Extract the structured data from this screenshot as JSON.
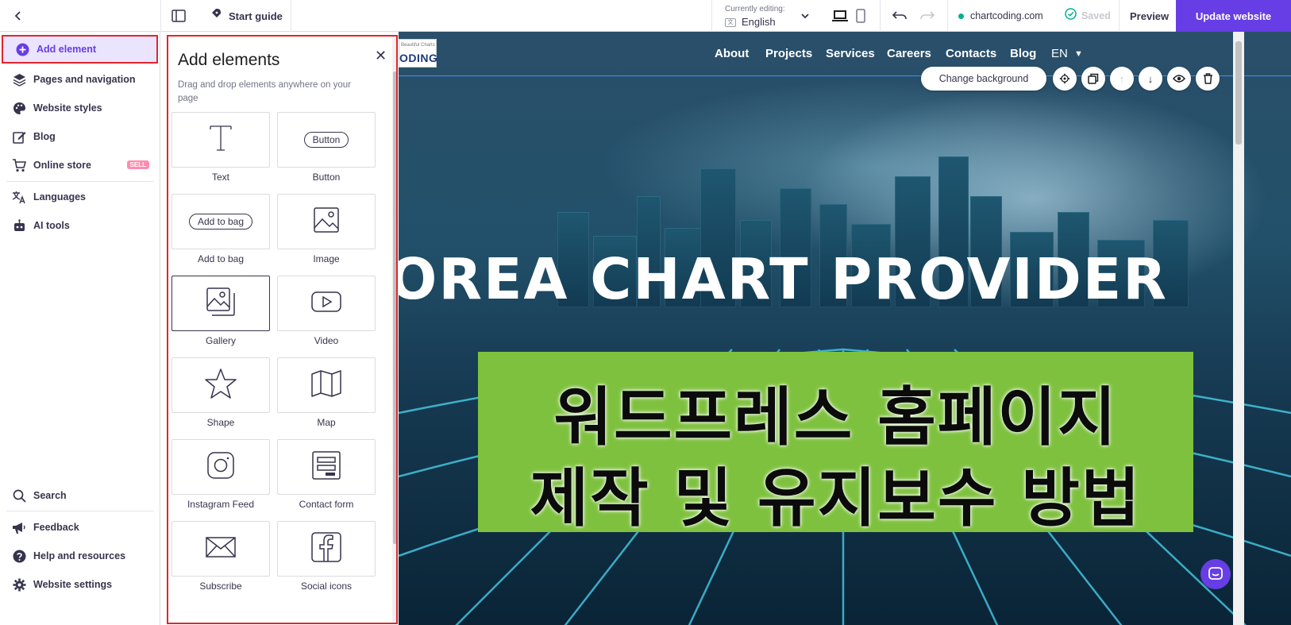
{
  "topbar": {
    "start_guide": "Start guide",
    "currently_editing_label": "Currently editing:",
    "language": "English",
    "domain": "chartcoding.com",
    "saved": "Saved",
    "preview": "Preview",
    "update_website": "Update website"
  },
  "sidebar": {
    "items": [
      {
        "label": "Add element",
        "icon": "plus-circle-icon"
      },
      {
        "label": "Pages and navigation",
        "icon": "layers-icon"
      },
      {
        "label": "Website styles",
        "icon": "palette-icon"
      },
      {
        "label": "Blog",
        "icon": "edit-icon"
      },
      {
        "label": "Online store",
        "icon": "cart-icon",
        "badge": "SELL"
      },
      {
        "label": "Languages",
        "icon": "translate-icon"
      },
      {
        "label": "AI tools",
        "icon": "robot-icon"
      }
    ],
    "bottom": [
      {
        "label": "Search",
        "icon": "search-icon"
      },
      {
        "label": "Feedback",
        "icon": "megaphone-icon"
      },
      {
        "label": "Help and resources",
        "icon": "help-icon"
      },
      {
        "label": "Website settings",
        "icon": "gear-icon"
      }
    ]
  },
  "panel": {
    "title": "Add elements",
    "subtitle": "Drag and drop elements anywhere on your page",
    "tiles": [
      {
        "label": "Text",
        "icon": "text-icon"
      },
      {
        "label": "Button",
        "icon": "button-icon",
        "pill": "Button"
      },
      {
        "label": "Add to bag",
        "icon": "add-to-bag-icon",
        "pill": "Add to bag"
      },
      {
        "label": "Image",
        "icon": "image-icon"
      },
      {
        "label": "Gallery",
        "icon": "gallery-icon"
      },
      {
        "label": "Video",
        "icon": "video-icon"
      },
      {
        "label": "Shape",
        "icon": "star-icon"
      },
      {
        "label": "Map",
        "icon": "map-icon"
      },
      {
        "label": "Instagram Feed",
        "icon": "instagram-icon"
      },
      {
        "label": "Contact form",
        "icon": "contact-form-icon"
      },
      {
        "label": "Subscribe",
        "icon": "envelope-icon"
      },
      {
        "label": "Social icons",
        "icon": "facebook-icon"
      }
    ]
  },
  "site": {
    "logo_small": "Beautiful Charts",
    "logo_text": "ODING",
    "nav": [
      "About",
      "Projects",
      "Services",
      "Careers",
      "Contacts",
      "Blog",
      "EN"
    ],
    "change_background": "Change background",
    "hero_title": "OREA CHART PROVIDER",
    "banner_line1": "워드프레스 홈페이지",
    "banner_line2": "제작 및 유지보수 방법"
  },
  "colors": {
    "accent": "#673de6",
    "highlight": "#e0262b",
    "banner_green": "#7ec13e"
  }
}
